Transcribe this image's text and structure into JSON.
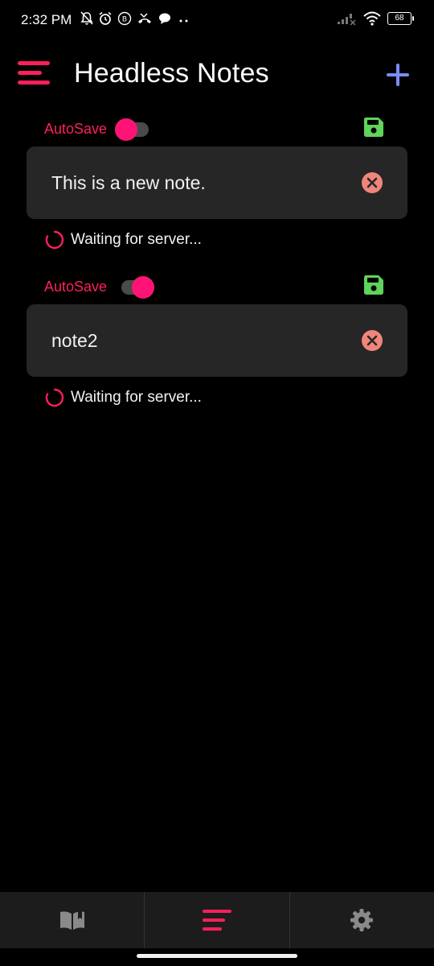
{
  "status_bar": {
    "time": "2:32 PM",
    "battery": "68",
    "icons_left": [
      "mute-bell-icon",
      "alarm-icon",
      "b-badge-icon",
      "missed-call-icon",
      "chat-bubble-icon",
      "more-dots-icon"
    ],
    "icons_right": [
      "signal-icon",
      "wifi-icon",
      "battery-icon"
    ]
  },
  "app_bar": {
    "title": "Headless Notes",
    "menu_icon": "menu-lines-icon",
    "add_icon": "plus-icon"
  },
  "colors": {
    "accent": "#ff1f5a",
    "toggle_thumb": "#ff1475",
    "save": "#5fd35a",
    "delete": "#f0857b",
    "add": "#7b8cf7",
    "card": "#262626"
  },
  "notes": [
    {
      "autosave_label": "AutoSave",
      "autosave_on": false,
      "text": "This is a new note.",
      "status": "Waiting for server..."
    },
    {
      "autosave_label": "AutoSave",
      "autosave_on": true,
      "text": "note2",
      "status": "Waiting for server..."
    }
  ],
  "bottom_nav": {
    "items": [
      {
        "icon": "book-icon",
        "active": false
      },
      {
        "icon": "list-lines-icon",
        "active": true
      },
      {
        "icon": "gear-icon",
        "active": false
      }
    ]
  }
}
